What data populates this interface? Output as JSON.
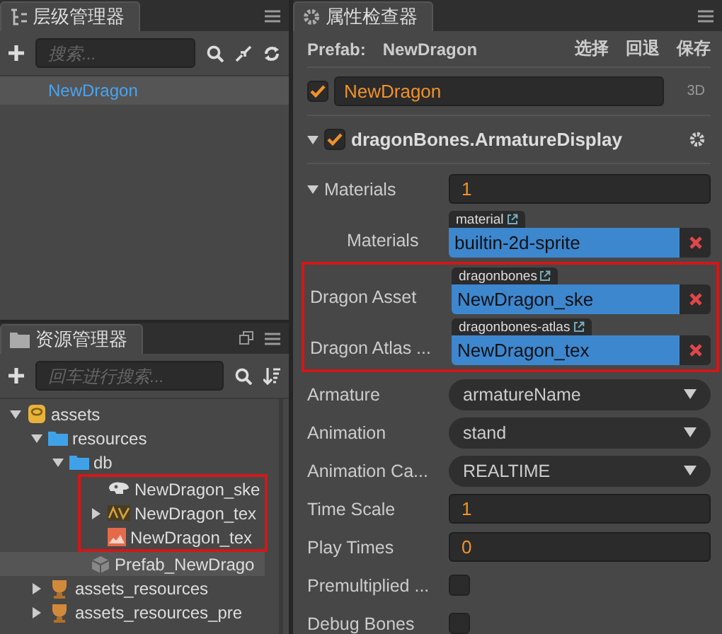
{
  "hierarchy": {
    "title": "层级管理器",
    "search": {
      "placeholder": "搜索..."
    },
    "nodes": [
      {
        "label": "NewDragon",
        "selected": true
      }
    ]
  },
  "assets": {
    "title": "资源管理器",
    "search": {
      "placeholder": "回车进行搜索..."
    },
    "tree": [
      {
        "label": "assets",
        "kind": "db",
        "expanded": true,
        "selected": false,
        "children": [
          {
            "label": "resources",
            "kind": "folder",
            "expanded": true,
            "selected": false,
            "children": [
              {
                "label": "db",
                "kind": "folder",
                "expanded": true,
                "selected": false,
                "children": [
                  {
                    "kind": "highlight_group",
                    "items": [
                      {
                        "label": "NewDragon_ske",
                        "kind": "skeleton",
                        "selected": false
                      },
                      {
                        "label": "NewDragon_tex",
                        "kind": "atlas",
                        "expanded": false,
                        "selected": false
                      },
                      {
                        "label": "NewDragon_tex",
                        "kind": "texture",
                        "selected": false
                      }
                    ]
                  },
                  {
                    "label": "Prefab_NewDrago",
                    "kind": "prefab",
                    "selected": true
                  }
                ]
              }
            ]
          },
          {
            "label": "assets_resources",
            "kind": "package",
            "expanded": false,
            "selected": false
          },
          {
            "label": "assets_resources_pre",
            "kind": "package",
            "expanded": false,
            "selected": false
          }
        ]
      }
    ]
  },
  "inspector": {
    "title": "属性检查器",
    "prefab_label": "Prefab:",
    "prefab_name": "NewDragon",
    "actions": [
      "选择",
      "回退",
      "保存"
    ],
    "node": {
      "name": "NewDragon",
      "enabled": true,
      "mode": "3D"
    },
    "component": {
      "name": "dragonBones.ArmatureDisplay",
      "enabled": true,
      "expanded": true
    },
    "properties": [
      {
        "kind": "number",
        "label": "Materials",
        "value": "1",
        "expanded": true,
        "children": [
          {
            "kind": "asset",
            "label": "Materials",
            "tag": "material",
            "value": "builtin-2d-sprite"
          }
        ]
      },
      {
        "kind": "highlight_group",
        "items": [
          {
            "kind": "asset",
            "label": "Dragon Asset",
            "tag": "dragonbones",
            "value": "NewDragon_ske"
          },
          {
            "kind": "asset",
            "label": "Dragon Atlas ...",
            "tag": "dragonbones-atlas",
            "value": "NewDragon_tex"
          }
        ]
      },
      {
        "kind": "select",
        "label": "Armature",
        "value": "armatureName"
      },
      {
        "kind": "select",
        "label": "Animation",
        "value": "stand"
      },
      {
        "kind": "select",
        "label": "Animation Ca...",
        "value": "REALTIME"
      },
      {
        "kind": "number",
        "label": "Time Scale",
        "value": "1"
      },
      {
        "kind": "number",
        "label": "Play Times",
        "value": "0"
      },
      {
        "kind": "checkbox",
        "label": "Premultiplied ...",
        "checked": false
      },
      {
        "kind": "checkbox",
        "label": "Debug Bones",
        "checked": false
      }
    ]
  }
}
